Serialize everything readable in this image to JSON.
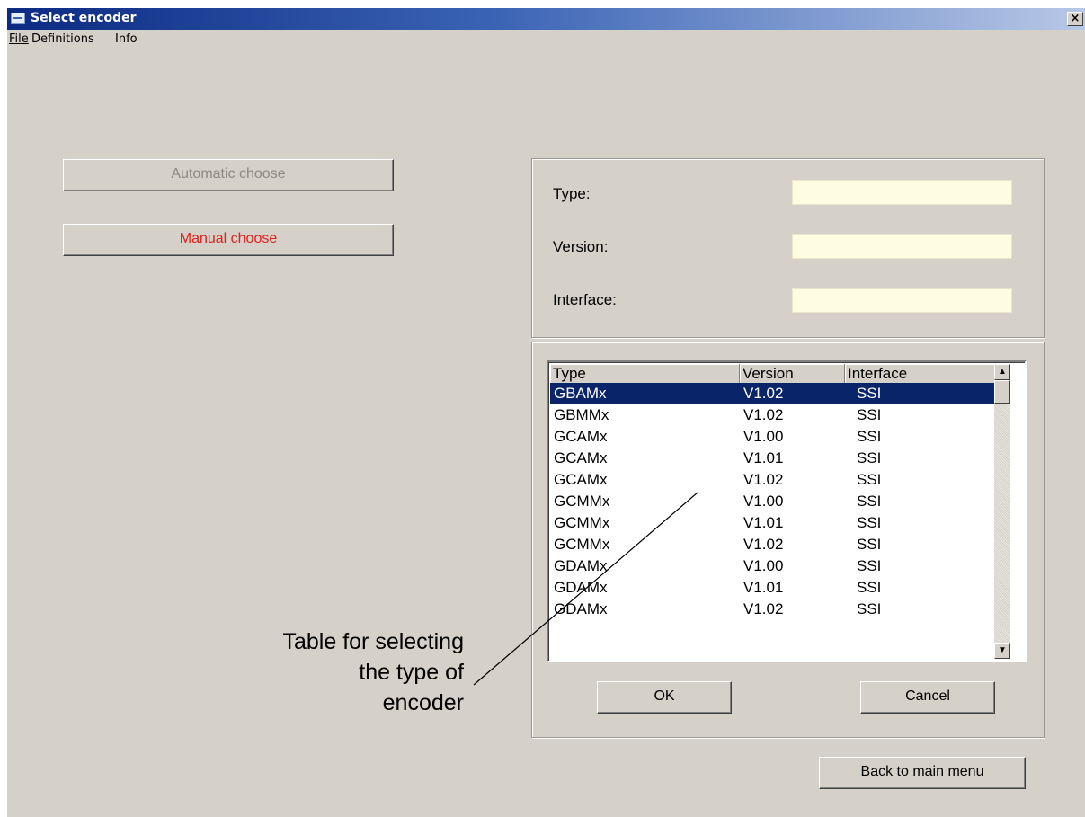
{
  "window": {
    "title": "Select encoder",
    "close_glyph": "×",
    "icon": "app-icon"
  },
  "menu": [
    {
      "label": "File"
    },
    {
      "label": "Definitions"
    },
    {
      "label": "Info"
    }
  ],
  "buttons": {
    "automatic": "Automatic choose",
    "manual": "Manual choose",
    "ok": "OK",
    "cancel": "Cancel",
    "back": "Back to main menu"
  },
  "fields": {
    "type_label": "Type:",
    "version_label": "Version:",
    "interface_label": "Interface:",
    "type_value": "",
    "version_value": "",
    "interface_value": ""
  },
  "table": {
    "headers": [
      "Type",
      "Version",
      "Interface"
    ],
    "rows": [
      [
        "GBAMx",
        "V1.02",
        "SSI"
      ],
      [
        "GBMMx",
        "V1.02",
        "SSI"
      ],
      [
        "GCAMx",
        "V1.00",
        "SSI"
      ],
      [
        "GCAMx",
        "V1.01",
        "SSI"
      ],
      [
        "GCAMx",
        "V1.02",
        "SSI"
      ],
      [
        "GCMMx",
        "V1.00",
        "SSI"
      ],
      [
        "GCMMx",
        "V1.01",
        "SSI"
      ],
      [
        "GCMMx",
        "V1.02",
        "SSI"
      ],
      [
        "GDAMx",
        "V1.00",
        "SSI"
      ],
      [
        "GDAMx",
        "V1.01",
        "SSI"
      ],
      [
        "GDAMx",
        "V1.02",
        "SSI"
      ]
    ],
    "selected_row": 0
  },
  "annotation": {
    "line1": "Table for selecting",
    "line2": "the type of",
    "line3": "encoder"
  },
  "colors": {
    "selection": "#0a246a",
    "manual_text": "#e0201c",
    "disabled_text": "#8c8a85",
    "field_bg": "#fffde1"
  }
}
